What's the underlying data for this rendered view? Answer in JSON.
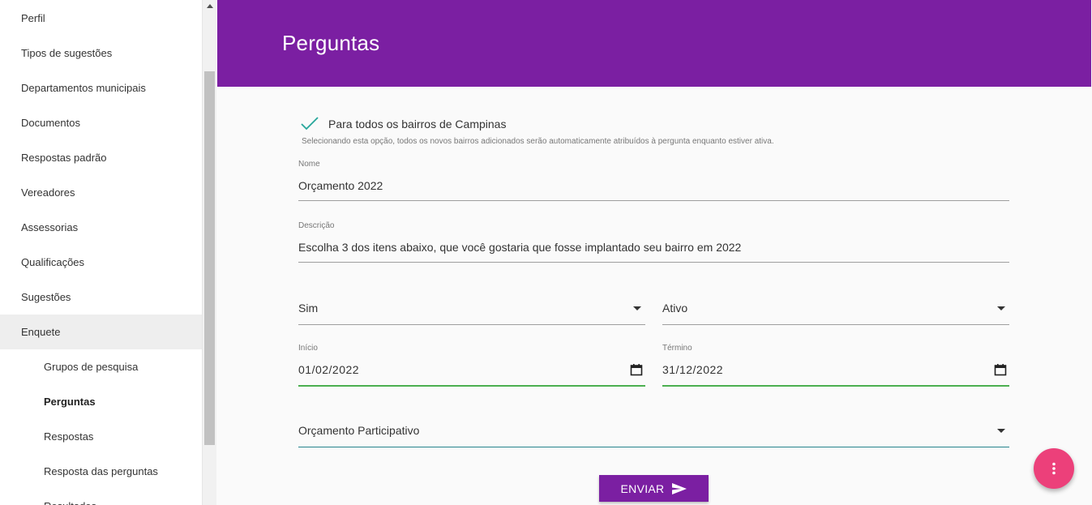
{
  "sidebar": {
    "items": [
      {
        "label": "Perfil"
      },
      {
        "label": "Tipos de sugestões"
      },
      {
        "label": "Departamentos municipais"
      },
      {
        "label": "Documentos"
      },
      {
        "label": "Respostas padrão"
      },
      {
        "label": "Vereadores"
      },
      {
        "label": "Assessorias"
      },
      {
        "label": "Qualificações"
      },
      {
        "label": "Sugestões"
      },
      {
        "label": "Enquete"
      }
    ],
    "subitems": [
      {
        "label": "Grupos de pesquisa"
      },
      {
        "label": "Perguntas"
      },
      {
        "label": "Respostas"
      },
      {
        "label": "Resposta das perguntas"
      },
      {
        "label": "Resultados"
      }
    ]
  },
  "header": {
    "title": "Perguntas"
  },
  "form": {
    "all_neighborhoods": {
      "label": "Para todos os bairros de Campinas",
      "checked": true,
      "helper": "Selecionando esta opção, todos os novos bairros adicionados serão automaticamente atribuídos à pergunta enquanto estiver ativa."
    },
    "name": {
      "label": "Nome",
      "value": "Orçamento 2022"
    },
    "description": {
      "label": "Descrição",
      "value": "Escolha 3 dos itens abaixo, que você gostaria que fosse implantado seu bairro em 2022"
    },
    "select_yes": {
      "value": "Sim"
    },
    "select_status": {
      "value": "Ativo"
    },
    "start": {
      "label": "Início",
      "value": "01/02/2022"
    },
    "end": {
      "label": "Término",
      "value": "31/12/2022"
    },
    "group": {
      "value": "Orçamento Participativo"
    },
    "submit_label": "ENVIAR"
  },
  "colors": {
    "primary": "#7b1fa2",
    "accent": "#ec407a",
    "check": "#26a69a",
    "focus": "#4caf50"
  },
  "icons": {
    "check": "check-icon",
    "calendar": "calendar-icon",
    "send": "send-icon",
    "fab": "more-vert-icon",
    "dropdown": "caret-down-icon"
  }
}
